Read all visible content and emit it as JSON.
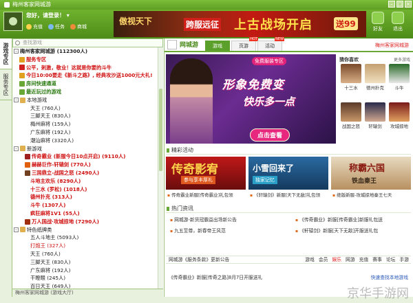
{
  "window": {
    "title": "梅州客家网城游"
  },
  "user": {
    "greeting": "您好，请登录！",
    "recharge": "充值",
    "task": "任务",
    "mall": "商城"
  },
  "banner": {
    "b1": "傲视天下",
    "b2": "跨服远征",
    "b3": "上古战场开启",
    "b4": "送99"
  },
  "top_buttons": [
    {
      "label": "好友"
    },
    {
      "label": "退出"
    }
  ],
  "vtabs": [
    "游戏专区",
    "服务专区"
  ],
  "search": {
    "placeholder": "查找游戏"
  },
  "tree": [
    {
      "t": "梅州客家网城游 (112300人)",
      "cls": "bold",
      "ind": 0,
      "tg": "-"
    },
    {
      "t": "服务专区",
      "cls": "red bold",
      "ind": 1,
      "ic": "#e0a020"
    },
    {
      "t": "公平，刺激，敬业！这就是你要的斗牛",
      "cls": "red bold",
      "ind": 1,
      "ic": "#d02020"
    },
    {
      "t": "今日10:00要走《新斗之路》, 经典攻沙送1000元大礼!",
      "cls": "red bold",
      "ind": 1,
      "ic": "#e0a020"
    },
    {
      "t": "房间快速通道",
      "cls": "green bold",
      "ind": 1,
      "ic": "#6aa836"
    },
    {
      "t": "最近玩过的游戏",
      "cls": "green bold",
      "ind": 1,
      "ic": "#6aa836"
    },
    {
      "t": "本地游戏",
      "cls": "",
      "ind": 0,
      "tg": "-",
      "ic": "#e0b050"
    },
    {
      "t": "天王 (760人)",
      "cls": "",
      "ind": 3
    },
    {
      "t": "三脚天王 (830人)",
      "cls": "",
      "ind": 3
    },
    {
      "t": "梅州麻将 (159人)",
      "cls": "",
      "ind": 3
    },
    {
      "t": "广东麻将 (192人)",
      "cls": "",
      "ind": 3
    },
    {
      "t": "潮汕麻将 (3320人)",
      "cls": "",
      "ind": 3
    },
    {
      "t": "新游戏",
      "cls": "",
      "ind": 0,
      "tg": "-",
      "ic": "#e0b050"
    },
    {
      "t": "传奇霸业 (新服今日10点开启) (9110人)",
      "cls": "red bold",
      "ind": 2,
      "ic": "#a02020"
    },
    {
      "t": "赫赫巨作-轩辕剑 (770人)",
      "cls": "red bold",
      "ind": 2,
      "ic": "#e06010"
    },
    {
      "t": "三国鼎立-战国之怒 (2490人)",
      "cls": "red bold",
      "ind": 2,
      "ic": "#704020"
    },
    {
      "t": "斗地主欢乐 (8290人)",
      "cls": "red bold",
      "ind": 3
    },
    {
      "t": "十三水 (罗松) (1018人)",
      "cls": "red bold",
      "ind": 3
    },
    {
      "t": "德州扑克 (313人)",
      "cls": "red bold",
      "ind": 3
    },
    {
      "t": "斗牛 (1307人)",
      "cls": "red bold",
      "ind": 3
    },
    {
      "t": "疯狂麻将1V1 (55人)",
      "cls": "red bold",
      "ind": 3
    },
    {
      "t": "万人国战·攻城掠地 (7290人)",
      "cls": "red bold",
      "ind": 2,
      "ic": "#a03010"
    },
    {
      "t": "特色纸牌类",
      "cls": "",
      "ind": 0,
      "tg": "-",
      "ic": "#e0b050"
    },
    {
      "t": "五人斗地主 (5093人)",
      "cls": "",
      "ind": 3
    },
    {
      "t": "打炮王 (327人)",
      "cls": "red",
      "ind": 3
    },
    {
      "t": "天王 (760人)",
      "cls": "",
      "ind": 3
    },
    {
      "t": "三脚天王 (830人)",
      "cls": "",
      "ind": 3
    },
    {
      "t": "广东麻将 (192人)",
      "cls": "",
      "ind": 3
    },
    {
      "t": "干瞪眼 (245人)",
      "cls": "",
      "ind": 3
    },
    {
      "t": "百日天王 (649人)",
      "cls": "",
      "ind": 3
    }
  ],
  "bottom_left": "梅州客家网城游 (游戏大厅)",
  "main": {
    "brand": "网城游",
    "tabs": [
      "游戏",
      "页游",
      "活动"
    ],
    "hot_badge": "HOT",
    "new_badge": "NEW",
    "header_right": "梅州客家网城游",
    "hero": {
      "badge": "免费服装专区",
      "t1": "形象免费变",
      "t2": "快乐多一点",
      "btn": "点击查看"
    },
    "rec_title": "猜你喜欢",
    "rec_more": "更多游戏",
    "rec": [
      "十三水",
      "德州扑克",
      "斗牛",
      "战国之怒",
      "轩辕剑",
      "攻城掠地"
    ],
    "sec_activity": "精彩活动",
    "acts": [
      {
        "big": "传奇影宥",
        "sub": "参与享丰厚礼",
        "cap": "传奇霸业新服[传奇霸业]礼包领"
      },
      {
        "big": "小雪回来了",
        "sub": "独家记忆",
        "cap": "《轩辕剑》新服[天下无敌]礼包领"
      },
      {
        "big": "称霸六国",
        "sub": "铁血秦王",
        "cap": "绝版新服-攻城掠地秦王七天"
      }
    ],
    "sec_news": "热门资讯",
    "news": [
      "网城游-新货冠霸益出场新公告",
      "九五至尊，新春帝王风范",
      "《传奇霸业》新服[传奇霸业]新服礼包送",
      "《轩辕剑》新服[天下无敌]开服送礼包"
    ],
    "linkbar": {
      "ann": "网城游《服务条款》更新公告",
      "links": [
        "游戏",
        "会员",
        "娱乐",
        "网游",
        "充值",
        "赛事",
        "论坛",
        "手游"
      ]
    },
    "ticker": "《传奇霸业》新服[传奇之路]8月7日开服送礼",
    "ticker_right": "快速查找本地游戏"
  },
  "watermark": "京华手游网"
}
